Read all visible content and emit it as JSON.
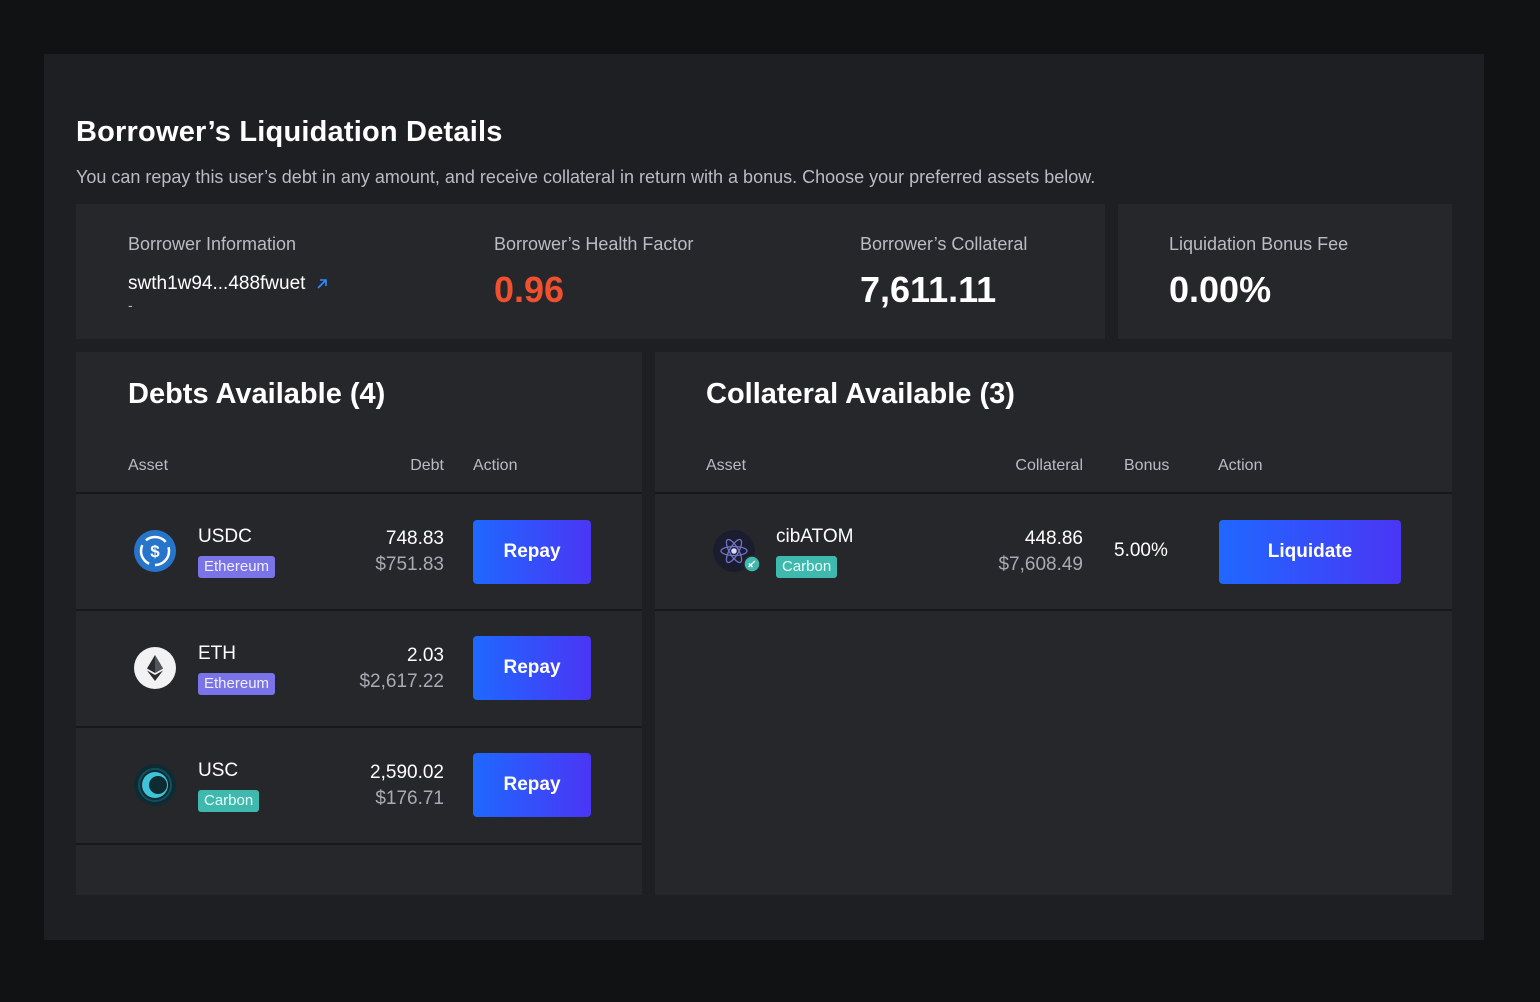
{
  "page": {
    "title": "Borrower’s Liquidation Details",
    "subtitle": "You can repay this user’s debt in any amount, and receive collateral in return with a bonus. Choose your preferred assets below."
  },
  "info": {
    "borrower_label": "Borrower Information",
    "borrower_address": "swth1w94...488fwuet",
    "borrower_sub": "-",
    "health_label": "Borrower’s Health Factor",
    "health_value": "0.96",
    "collateral_label": "Borrower’s Collateral",
    "collateral_value": "7,611.11",
    "fee_label": "Liquidation Bonus Fee",
    "fee_value": "0.00%"
  },
  "debts": {
    "title": "Debts Available (4)",
    "headers": {
      "asset": "Asset",
      "debt": "Debt",
      "action": "Action"
    },
    "rows": [
      {
        "asset": "USDC",
        "chain": "Ethereum",
        "amount": "748.83",
        "usd": "$751.83",
        "action": "Repay",
        "icon": "usdc-icon"
      },
      {
        "asset": "ETH",
        "chain": "Ethereum",
        "amount": "2.03",
        "usd": "$2,617.22",
        "action": "Repay",
        "icon": "eth-icon"
      },
      {
        "asset": "USC",
        "chain": "Carbon",
        "amount": "2,590.02",
        "usd": "$176.71",
        "action": "Repay",
        "icon": "usc-icon"
      }
    ]
  },
  "collateral": {
    "title": "Collateral Available (3)",
    "headers": {
      "asset": "Asset",
      "collateral": "Collateral",
      "bonus": "Bonus",
      "action": "Action"
    },
    "rows": [
      {
        "asset": "cibATOM",
        "chain": "Carbon",
        "amount": "448.86",
        "usd": "$7,608.49",
        "bonus": "5.00%",
        "action": "Liquidate",
        "icon": "cibatom-icon"
      }
    ]
  },
  "colors": {
    "background": "#111214",
    "panel": "#1e1f22",
    "card": "#26272b",
    "health_red": "#f0502e",
    "button_start": "#1f68ff",
    "button_end": "#4a36f5",
    "chip_ethereum": "#7b74e8",
    "chip_carbon": "#3fb9ad"
  }
}
